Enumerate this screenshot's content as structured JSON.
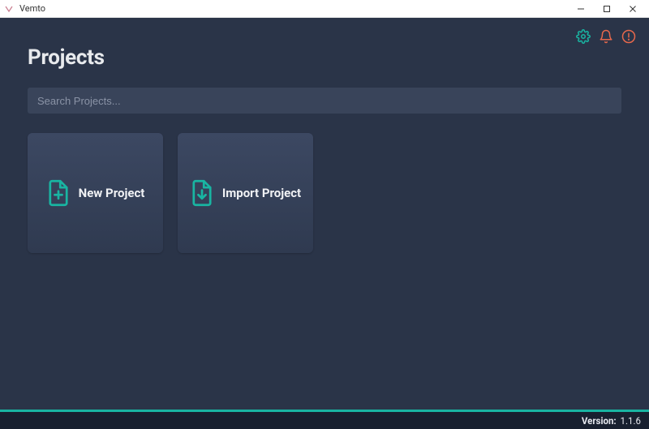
{
  "window": {
    "title": "Vemto"
  },
  "topbar": {
    "settings_icon": "gear",
    "notifications_icon": "bell",
    "alert_icon": "alert"
  },
  "page": {
    "title": "Projects"
  },
  "search": {
    "placeholder": "Search Projects..."
  },
  "cards": {
    "new_project": {
      "label": "New Project"
    },
    "import_project": {
      "label": "Import Project"
    }
  },
  "footer": {
    "version_label": "Version:",
    "version_value": "1.1.6"
  },
  "colors": {
    "accent": "#19b5a2",
    "alert": "#e7684c",
    "bg": "#2a3448",
    "card": "#3c4862"
  }
}
